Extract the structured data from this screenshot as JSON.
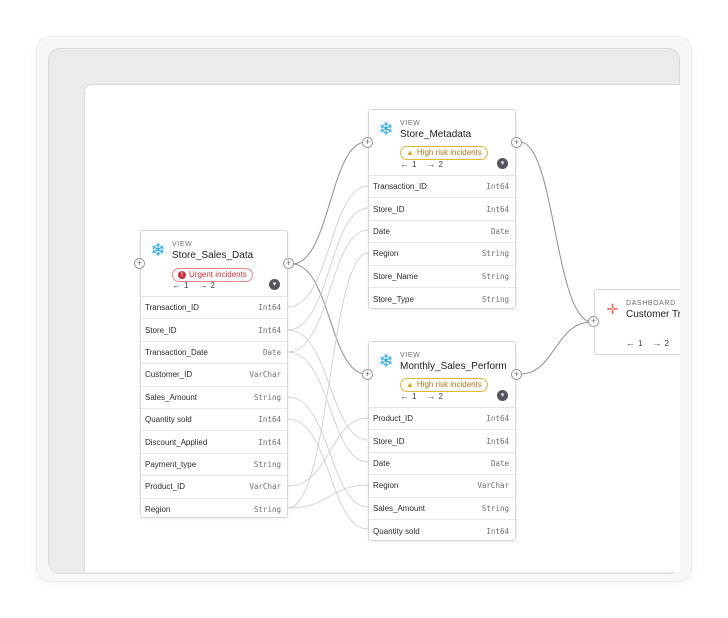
{
  "nodes": {
    "store_sales": {
      "kind": "VIEW",
      "title": "Store_Sales_Data",
      "badge": "Urgent incidents",
      "upstream": "1",
      "downstream": "2",
      "fields": [
        {
          "name": "Transaction_ID",
          "type": "Int64"
        },
        {
          "name": "Store_ID",
          "type": "Int64"
        },
        {
          "name": "Transaction_Date",
          "type": "Date"
        },
        {
          "name": "Customer_ID",
          "type": "VarChar"
        },
        {
          "name": "Sales_Amount",
          "type": "String"
        },
        {
          "name": "Quantity sold",
          "type": "Int64"
        },
        {
          "name": "Discount_Applied",
          "type": "Int64"
        },
        {
          "name": "Payment_type",
          "type": "String"
        },
        {
          "name": "Product_ID",
          "type": "VarChar"
        },
        {
          "name": "Region",
          "type": "String"
        }
      ]
    },
    "store_metadata": {
      "kind": "VIEW",
      "title": "Store_Metadata",
      "badge": "High risk incidents",
      "upstream": "1",
      "downstream": "2",
      "fields": [
        {
          "name": "Transaction_ID",
          "type": "Int64"
        },
        {
          "name": "Store_ID",
          "type": "Int64"
        },
        {
          "name": "Date",
          "type": "Date"
        },
        {
          "name": "Region",
          "type": "String"
        },
        {
          "name": "Store_Name",
          "type": "String"
        },
        {
          "name": "Store_Type",
          "type": "String"
        }
      ]
    },
    "monthly_sales": {
      "kind": "VIEW",
      "title": "Monthly_Sales_Performa...",
      "badge": "High risk incidents",
      "upstream": "1",
      "downstream": "2",
      "fields": [
        {
          "name": "Product_ID",
          "type": "Int64"
        },
        {
          "name": "Store_ID",
          "type": "Int64"
        },
        {
          "name": "Date",
          "type": "Date"
        },
        {
          "name": "Region",
          "type": "VarChar"
        },
        {
          "name": "Sales_Amount",
          "type": "String"
        },
        {
          "name": "Quantity sold",
          "type": "Int64"
        }
      ]
    },
    "dashboard": {
      "kind": "DASHBOARD",
      "title": "Customer Tra",
      "upstream": "1",
      "downstream": "2"
    }
  },
  "icons": {
    "view": "snowflake-icon",
    "dashboard": "tableau-icon",
    "urgent": "error-icon",
    "high": "warning-icon",
    "upstream": "arrow-left-icon",
    "downstream": "arrow-right-icon",
    "expand": "chevron-down-icon",
    "add": "plus-icon"
  },
  "colors": {
    "urgent": "#c4323b",
    "high_risk": "#d9a21e",
    "snowflake": "#2aa8e0",
    "tableau": "#e56a54",
    "edge": "#8e8e94"
  }
}
